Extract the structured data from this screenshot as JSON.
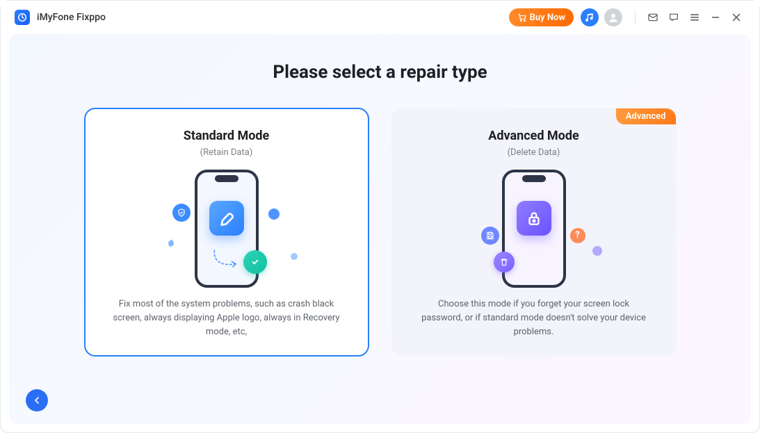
{
  "app": {
    "title": "iMyFone Fixppo"
  },
  "titlebar": {
    "buy_now": "Buy Now"
  },
  "heading": "Please select a repair type",
  "cards": {
    "standard": {
      "title": "Standard Mode",
      "subtitle": "(Retain Data)",
      "description": "Fix most of the system problems, such as crash black screen, always displaying Apple logo, always in Recovery mode, etc,"
    },
    "advanced": {
      "badge": "Advanced",
      "title": "Advanced Mode",
      "subtitle": "(Delete Data)",
      "description": "Choose this mode if you forget your screen lock password, or if standard mode doesn't solve your device problems."
    }
  }
}
